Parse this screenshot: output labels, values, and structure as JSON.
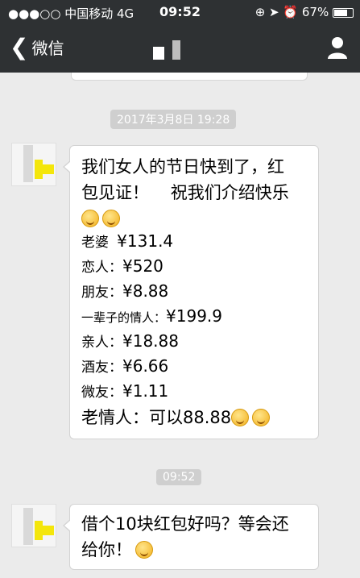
{
  "status_bar": {
    "carrier": "●●●○○ 中国移动  4G",
    "time": "09:52",
    "battery": "67%",
    "icons": [
      "location-icon",
      "alarm-icon",
      "battery-icon",
      "orientation-lock-icon"
    ]
  },
  "nav": {
    "back_label": "微信",
    "back_icon": "chevron-left-icon",
    "profile_icon": "person-icon"
  },
  "messages": [
    {
      "timestamp": "2017年3月8日 19:28",
      "intro": [
        "我们女人的节日快到了，红",
        "包见证！    祝我们介绍快乐"
      ],
      "items": [
        {
          "label": "老婆",
          "value": "¥131.4"
        },
        {
          "label": "恋人：",
          "value": "¥520"
        },
        {
          "label": "朋友：",
          "value": "¥8.88"
        },
        {
          "label": "一辈子的情人：",
          "value": "¥199.9"
        },
        {
          "label": "亲人：",
          "value": "¥18.88"
        },
        {
          "label": "酒友：",
          "value": "¥6.66"
        },
        {
          "label": "微友：",
          "value": "¥1.11"
        }
      ],
      "closing": "老情人：可以88.88"
    },
    {
      "timestamp": "09:52",
      "lines": [
        "借个10块红包好吗？等会还",
        "给你！"
      ]
    }
  ],
  "colors": {
    "bar": "#2e3133",
    "chat_bg": "#ebebeb",
    "bubble": "#ffffff",
    "timestamp_bg": "#cfcfcf"
  }
}
